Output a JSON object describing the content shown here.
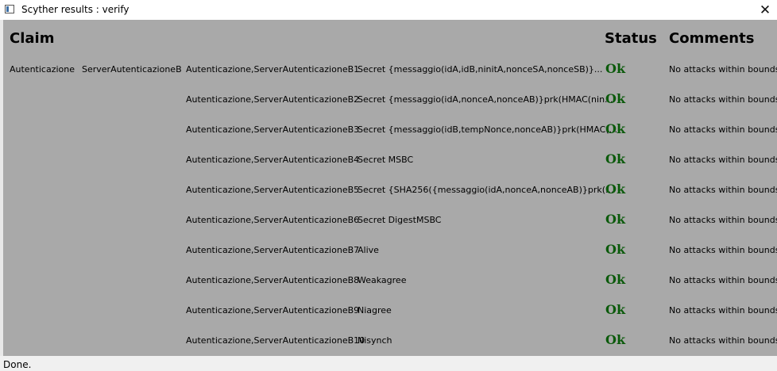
{
  "window": {
    "title": "Scyther results : verify",
    "close_glyph": "✕"
  },
  "headers": {
    "claim": "Claim",
    "status": "Status",
    "comments": "Comments"
  },
  "group": {
    "protocol": "Autenticazione",
    "role": "ServerAutenticazioneB"
  },
  "rows": [
    {
      "id": "Autenticazione,ServerAutenticazioneB1",
      "claim": "Secret {messaggio(idA,idB,ninitA,nonceSA,nonceSB)}...",
      "status": "Ok",
      "comment": "No attacks within bounds."
    },
    {
      "id": "Autenticazione,ServerAutenticazioneB2",
      "claim": "Secret {messaggio(idA,nonceA,nonceAB)}prk(HMAC(nin...",
      "status": "Ok",
      "comment": "No attacks within bounds."
    },
    {
      "id": "Autenticazione,ServerAutenticazioneB3",
      "claim": "Secret {messaggio(idB,tempNonce,nonceAB)}prk(HMAC(...",
      "status": "Ok",
      "comment": "No attacks within bounds."
    },
    {
      "id": "Autenticazione,ServerAutenticazioneB4",
      "claim": "Secret MSBC",
      "status": "Ok",
      "comment": "No attacks within bounds."
    },
    {
      "id": "Autenticazione,ServerAutenticazioneB5",
      "claim": "Secret {SHA256({messaggio(idA,nonceA,nonceAB)}prk(...",
      "status": "Ok",
      "comment": "No attacks within bounds."
    },
    {
      "id": "Autenticazione,ServerAutenticazioneB6",
      "claim": "Secret DigestMSBC",
      "status": "Ok",
      "comment": "No attacks within bounds."
    },
    {
      "id": "Autenticazione,ServerAutenticazioneB7",
      "claim": "Alive",
      "status": "Ok",
      "comment": "No attacks within bounds."
    },
    {
      "id": "Autenticazione,ServerAutenticazioneB8",
      "claim": "Weakagree",
      "status": "Ok",
      "comment": "No attacks within bounds."
    },
    {
      "id": "Autenticazione,ServerAutenticazioneB9",
      "claim": "Niagree",
      "status": "Ok",
      "comment": "No attacks within bounds."
    },
    {
      "id": "Autenticazione,ServerAutenticazioneB10",
      "claim": "Nisynch",
      "status": "Ok",
      "comment": "No attacks within bounds."
    }
  ],
  "statusbar": {
    "text": "Done."
  },
  "colors": {
    "panel_bg": "#a9a9a9",
    "ok_green": "#0b5a0b"
  }
}
